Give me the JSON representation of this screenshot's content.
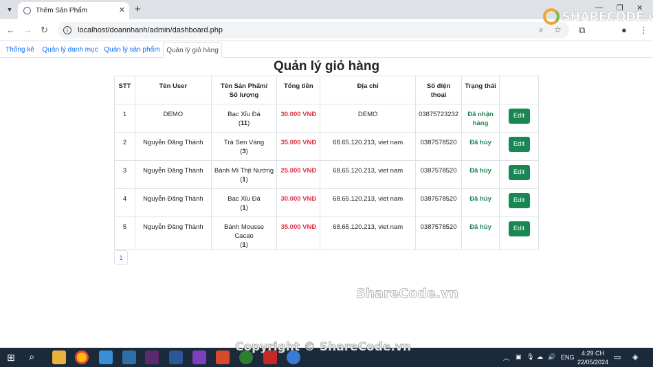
{
  "browser": {
    "tab_title": "Thêm Sản Phẩm",
    "url": "localhost/doannhanh/admin/dashboard.php"
  },
  "watermark": {
    "logo_text": "SHARECODE.vn",
    "center_text": "ShareCode.vn",
    "bottom_text": "Copyright © ShareCode.vn"
  },
  "nav": {
    "tabs": [
      "Thống kê",
      "Quản lý danh mục",
      "Quản lý sản phẩm",
      "Quản lý giỏ hàng"
    ],
    "active_index": 3
  },
  "page": {
    "title": "Quản lý giỏ hàng"
  },
  "table": {
    "headers": [
      "STT",
      "Tên User",
      "Tên Sản Phẩm/\nSố lượng",
      "Tổng tiền",
      "Địa chỉ",
      "Số điện\nthoại",
      "Trạng thái",
      ""
    ],
    "rows": [
      {
        "stt": "1",
        "user": "DEMO",
        "product": "Bạc Xỉu Đá",
        "qty": "11",
        "total": "30.000 VNĐ",
        "address": "DEMO",
        "phone": "03875723232",
        "status": "Đã nhận\nhàng",
        "action": "Edit"
      },
      {
        "stt": "2",
        "user": "Nguyễn Đăng Thành",
        "product": "Trà Sen Vàng",
        "qty": "3",
        "total": "35.000 VNĐ",
        "address": "68.65.120.213, viet nam",
        "phone": "0387578520",
        "status": "Đã hủy",
        "action": "Edit"
      },
      {
        "stt": "3",
        "user": "Nguyễn Đăng Thành",
        "product": "Bánh Mì Thịt Nướng",
        "qty": "1",
        "total": "25.000 VNĐ",
        "address": "68.65.120.213, viet nam",
        "phone": "0387578520",
        "status": "Đã hủy",
        "action": "Edit"
      },
      {
        "stt": "4",
        "user": "Nguyễn Đăng Thành",
        "product": "Bạc Xỉu Đá",
        "qty": "1",
        "total": "30.000 VNĐ",
        "address": "68.65.120.213, viet nam",
        "phone": "0387578520",
        "status": "Đã hủy",
        "action": "Edit"
      },
      {
        "stt": "5",
        "user": "Nguyễn Đăng Thành",
        "product": "Bánh Mousse Cacao",
        "qty": "1",
        "total": "35.000 VNĐ",
        "address": "68.65.120.213, viet nam",
        "phone": "0387578520",
        "status": "Đã hủy",
        "action": "Edit"
      }
    ]
  },
  "pagination": {
    "pages": [
      "1"
    ]
  },
  "taskbar": {
    "language": "ENG",
    "time": "4:29 CH",
    "date": "22/05/2024"
  },
  "colors": {
    "price": "#dc3545",
    "status": "#198754",
    "edit_button": "#198754",
    "link": "#0d6efd",
    "taskbar": "#1b2a3b"
  }
}
